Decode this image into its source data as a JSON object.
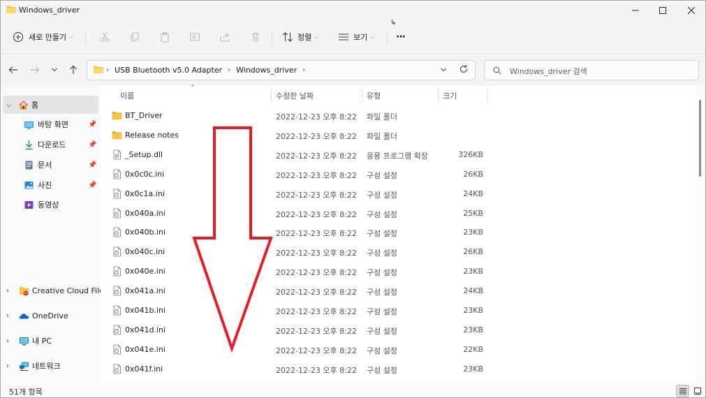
{
  "window": {
    "title": "Windows_driver"
  },
  "toolbar": {
    "new_label": "새로 만들기",
    "sort_label": "정렬",
    "view_label": "보기",
    "more_label": "···"
  },
  "nav": {
    "breadcrumb": [
      "USB Bluetooth v5.0 Adapter",
      "Windows_driver"
    ],
    "search_placeholder": "Windows_driver 검색"
  },
  "sidebar": {
    "home_label": "홈",
    "quick_access": [
      {
        "label": "바탕 화면",
        "icon": "desktop-icon"
      },
      {
        "label": "다운로드",
        "icon": "download-icon"
      },
      {
        "label": "문서",
        "icon": "document-icon"
      },
      {
        "label": "사진",
        "icon": "picture-icon"
      },
      {
        "label": "동영상",
        "icon": "video-icon"
      }
    ],
    "locations": [
      {
        "label": "Creative Cloud Files",
        "icon": "creative-cloud-icon"
      },
      {
        "label": "OneDrive",
        "icon": "onedrive-icon"
      },
      {
        "label": "내 PC",
        "icon": "pc-icon"
      },
      {
        "label": "네트워크",
        "icon": "network-icon"
      }
    ]
  },
  "columns": {
    "name": "이름",
    "date": "수정한 날짜",
    "type": "유형",
    "size": "크기"
  },
  "files": [
    {
      "name": "BT_Driver",
      "date": "2022-12-23 오후 8:22",
      "type": "파일 폴더",
      "size": "",
      "kind": "folder"
    },
    {
      "name": "Release notes",
      "date": "2022-12-23 오후 8:22",
      "type": "파일 폴더",
      "size": "",
      "kind": "folder"
    },
    {
      "name": "_Setup.dll",
      "date": "2022-12-23 오후 8:22",
      "type": "응용 프로그램 확장",
      "size": "326KB",
      "kind": "dll"
    },
    {
      "name": "0x0c0c.ini",
      "date": "2022-12-23 오후 8:22",
      "type": "구성 설정",
      "size": "26KB",
      "kind": "ini"
    },
    {
      "name": "0x0c1a.ini",
      "date": "2022-12-23 오후 8:22",
      "type": "구성 설정",
      "size": "24KB",
      "kind": "ini"
    },
    {
      "name": "0x040a.ini",
      "date": "2022-12-23 오후 8:22",
      "type": "구성 설정",
      "size": "25KB",
      "kind": "ini"
    },
    {
      "name": "0x040b.ini",
      "date": "2022-12-23 오후 8:22",
      "type": "구성 설정",
      "size": "23KB",
      "kind": "ini"
    },
    {
      "name": "0x040c.ini",
      "date": "2022-12-23 오후 8:22",
      "type": "구성 설정",
      "size": "26KB",
      "kind": "ini"
    },
    {
      "name": "0x040e.ini",
      "date": "2022-12-23 오후 8:22",
      "type": "구성 설정",
      "size": "23KB",
      "kind": "ini"
    },
    {
      "name": "0x041a.ini",
      "date": "2022-12-23 오후 8:22",
      "type": "구성 설정",
      "size": "24KB",
      "kind": "ini"
    },
    {
      "name": "0x041b.ini",
      "date": "2022-12-23 오후 8:22",
      "type": "구성 설정",
      "size": "23KB",
      "kind": "ini"
    },
    {
      "name": "0x041d.ini",
      "date": "2022-12-23 오후 8:22",
      "type": "구성 설정",
      "size": "23KB",
      "kind": "ini"
    },
    {
      "name": "0x041e.ini",
      "date": "2022-12-23 오후 8:22",
      "type": "구성 설정",
      "size": "22KB",
      "kind": "ini"
    },
    {
      "name": "0x041f.ini",
      "date": "2022-12-23 오후 8:22",
      "type": "구성 설정",
      "size": "23KB",
      "kind": "ini"
    }
  ],
  "status": {
    "count": "51개 항목"
  },
  "colors": {
    "folder": "#f6c444",
    "accent": "#0067c0",
    "annotation_arrow": "#e81c24"
  }
}
